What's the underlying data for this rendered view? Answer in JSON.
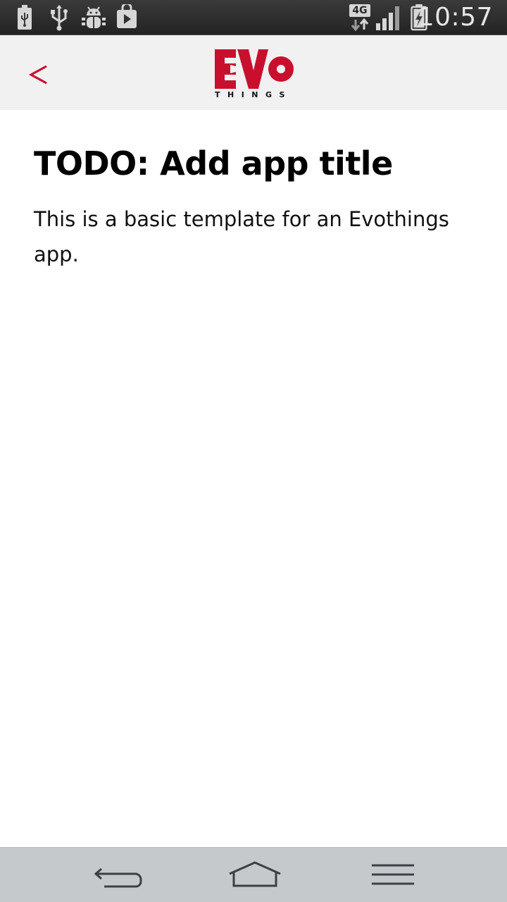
{
  "status_bar": {
    "time": "10:57",
    "network_type": "4G",
    "icons": [
      "usb-battery-icon",
      "usb-icon",
      "android-debug-icon",
      "play-store-icon",
      "network-4g-icon",
      "signal-strength-icon",
      "battery-charging-icon"
    ]
  },
  "header": {
    "back_icon": "chevron-left-icon",
    "logo": {
      "name": "evothings-logo",
      "wordmark": "EVO",
      "tagline": "THINGS"
    }
  },
  "main": {
    "title": "TODO: Add app title",
    "description": "This is a basic template for an Evothings app."
  },
  "nav_bar": {
    "buttons": [
      "back-nav-icon",
      "home-nav-icon",
      "menu-nav-icon"
    ]
  },
  "colors": {
    "accent": "#c8102e",
    "status_bar": "#2b2b2b",
    "header_bg": "#f1f1f1",
    "nav_bar_bg": "#c6c9cc"
  }
}
